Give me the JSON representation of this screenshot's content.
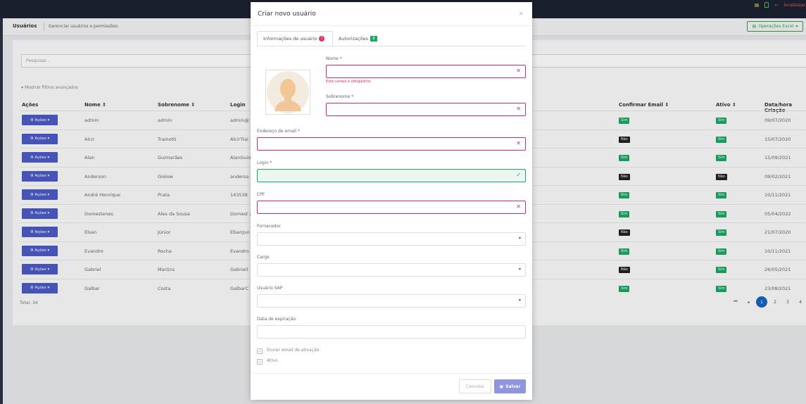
{
  "topbar": {
    "user_text": "localiza\\ac"
  },
  "header": {
    "title": "Usuários",
    "subtitle": "Gerenciar usuários e permissões.",
    "excel_label": "Operações Excel"
  },
  "search": {
    "placeholder": "Pesquisar..."
  },
  "filters_link": "Mostrar filtros avançados",
  "columns": [
    "Ações",
    "Nome",
    "Sobrenome",
    "Login",
    "Confirmar Email",
    "Ativo",
    "Data/hora Criação"
  ],
  "action_label": "Ações",
  "rows": [
    {
      "nome": "admin",
      "sobrenome": "admin",
      "login": "admin@",
      "confirmar": "Sim",
      "ativo": "Sim",
      "data": "09/07/2020"
    },
    {
      "nome": "Alcir",
      "sobrenome": "Trainotti",
      "login": "AlcirTrai",
      "confirmar": "Não",
      "ativo": "Sim",
      "data": "15/07/2020"
    },
    {
      "nome": "Alan",
      "sobrenome": "Guimarães",
      "login": "AlanGuim",
      "confirmar": "Sim",
      "ativo": "Sim",
      "data": "15/09/2021"
    },
    {
      "nome": "Anderson",
      "sobrenome": "Giolow",
      "login": "andersa",
      "confirmar": "Não",
      "ativo": "Não",
      "data": "09/02/2021"
    },
    {
      "nome": "André Henrique",
      "sobrenome": "Prata",
      "login": "143538",
      "confirmar": "Sim",
      "ativo": "Sim",
      "data": "10/11/2021"
    },
    {
      "nome": "Domestenes",
      "sobrenome": "Alex da Sousa",
      "login": "Domest acalza",
      "confirmar": "Sim",
      "ativo": "Sim",
      "data": "05/04/2022"
    },
    {
      "nome": "Elsan",
      "sobrenome": "Júnior",
      "login": "ElsanJun",
      "confirmar": "Não",
      "ativo": "Sim",
      "data": "21/07/2020"
    },
    {
      "nome": "Evandro",
      "sobrenome": "Rocha",
      "login": "Evandro",
      "confirmar": "Sim",
      "ativo": "Sim",
      "data": "10/11/2021"
    },
    {
      "nome": "Gabriel",
      "sobrenome": "Martins",
      "login": "Gabriell",
      "confirmar": "Não",
      "ativo": "Sim",
      "data": "26/05/2021"
    },
    {
      "nome": "Galbar",
      "sobrenome": "Costa",
      "login": "GalbarC",
      "confirmar": "Sim",
      "ativo": "Sim",
      "data": "23/08/2021"
    }
  ],
  "total": "Total: 34",
  "pagination": {
    "pages": [
      "1",
      "2",
      "3",
      "4"
    ],
    "current": "1"
  },
  "modal": {
    "title": "Criar novo usuário",
    "close": "×",
    "tab_info": "Informações de usuário",
    "tab_info_badge": "!",
    "tab_auth": "Autorizações",
    "tab_auth_badge": "8",
    "nome_label": "Nome *",
    "nome_error": "Este campo é obrigatório.",
    "sobrenome_label": "Sobrenome *",
    "email_label": "Endereço de email *",
    "login_label": "Login *",
    "cpf_label": "CPF",
    "fornecedor_label": "Fornecedor",
    "cargo_label": "Cargo",
    "sap_label": "Usuário SAP",
    "expiracao_label": "Data de expiração",
    "enviar_email_label": "Enviar email de ativação.",
    "ativo_label": "Ativo",
    "cancel_label": "Cancelar",
    "save_label": "Salvar"
  }
}
